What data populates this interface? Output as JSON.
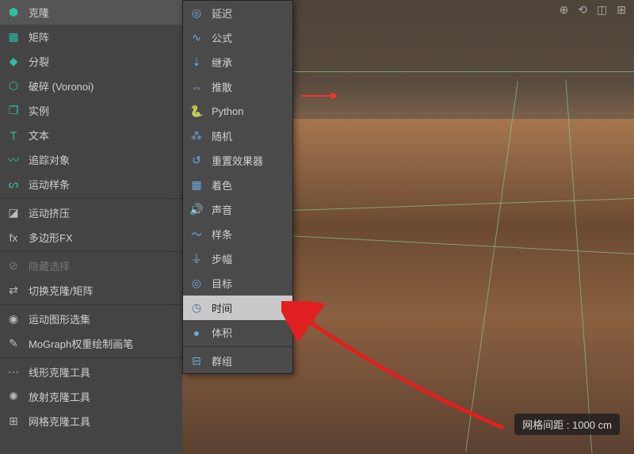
{
  "left_menu": {
    "items": [
      {
        "label": "克隆"
      },
      {
        "label": "矩阵"
      },
      {
        "label": "分裂"
      },
      {
        "label": "破碎 (Voronoi)"
      },
      {
        "label": "实例"
      },
      {
        "label": "文本"
      },
      {
        "label": "追踪对象"
      },
      {
        "label": "运动样条"
      }
    ],
    "group2": [
      {
        "label": "运动挤压"
      },
      {
        "label": "多边形FX"
      }
    ],
    "group3": [
      {
        "label": "隐藏选择",
        "disabled": true
      },
      {
        "label": "切换克隆/矩阵"
      }
    ],
    "group4": [
      {
        "label": "运动图形选集"
      },
      {
        "label": "MoGraph权重绘制画笔"
      }
    ],
    "group5": [
      {
        "label": "线形克隆工具"
      },
      {
        "label": "放射克隆工具"
      },
      {
        "label": "网格克隆工具"
      }
    ]
  },
  "submenu": {
    "items": [
      {
        "label": "延迟"
      },
      {
        "label": "公式"
      },
      {
        "label": "继承"
      },
      {
        "label": "推散"
      },
      {
        "label": "Python"
      },
      {
        "label": "随机"
      },
      {
        "label": "重置效果器"
      },
      {
        "label": "着色"
      },
      {
        "label": "声音"
      },
      {
        "label": "样条"
      },
      {
        "label": "步幅"
      },
      {
        "label": "目标"
      },
      {
        "label": "时间",
        "highlighted": true
      },
      {
        "label": "体积"
      },
      {
        "label": "群组"
      }
    ]
  },
  "viewport": {
    "grid_label": "网格间距 : 1000 cm"
  }
}
